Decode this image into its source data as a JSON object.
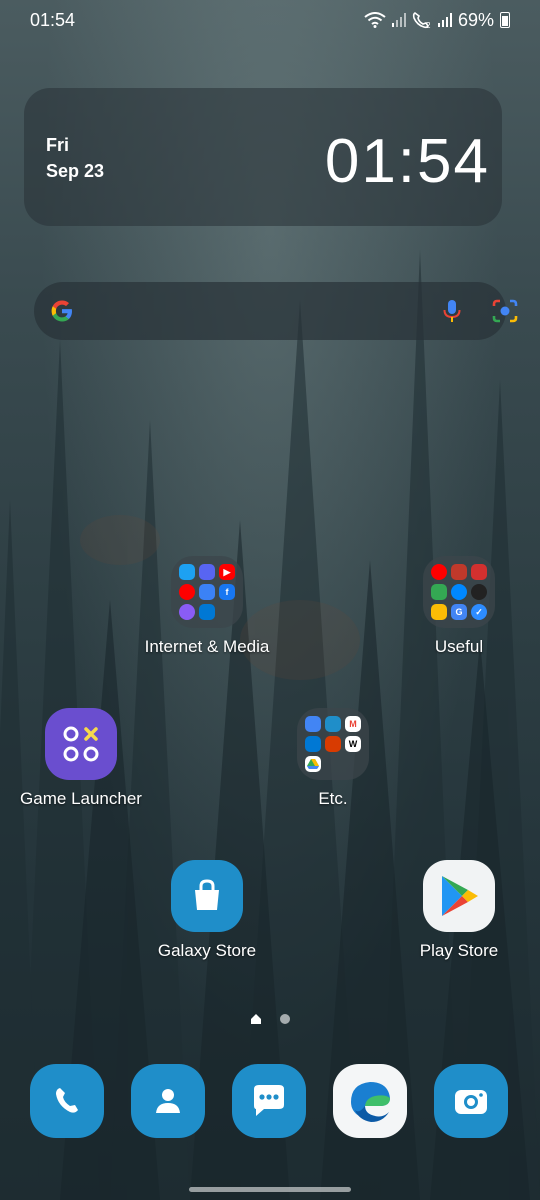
{
  "status_bar": {
    "time": "01:54",
    "battery_percent": "69%",
    "battery_level": 0.69
  },
  "clock_widget": {
    "day": "Fri",
    "date": "Sep 23",
    "time": "01:54"
  },
  "search_bar": {
    "icons": [
      "google-g-icon",
      "mic-icon",
      "google-lens-icon"
    ]
  },
  "home": {
    "folders": [
      {
        "label": "Internet & Media",
        "apps": [
          "twitter",
          "discord",
          "youtube",
          "youtube-music",
          "news",
          "facebook",
          "messenger",
          "outlook"
        ]
      },
      {
        "label": "Useful",
        "apps": [
          "youtube-red",
          "signal-bars",
          "lidl",
          "google-maps",
          "shazam",
          "speedometer",
          "google-photos",
          "google-translate",
          "check"
        ]
      },
      {
        "label": "Etc.",
        "apps": [
          "docs",
          "settings",
          "gmail",
          "outlook",
          "office",
          "wikipedia",
          "google-drive"
        ]
      }
    ],
    "apps": [
      {
        "label": "Game Launcher",
        "color": "#6a4ecf"
      },
      {
        "label": "Galaxy Store",
        "color": "#1f8ec9"
      },
      {
        "label": "Play Store",
        "color": "#f1f3f4"
      }
    ]
  },
  "page_indicator": {
    "pages": 2,
    "current": 1
  },
  "dock": {
    "apps": [
      "phone-icon",
      "contacts-icon",
      "messages-icon",
      "edge-icon",
      "camera-icon"
    ]
  },
  "colors": {
    "accent_blue": "#1f8ec9",
    "game_launcher": "#6a4ecf"
  }
}
